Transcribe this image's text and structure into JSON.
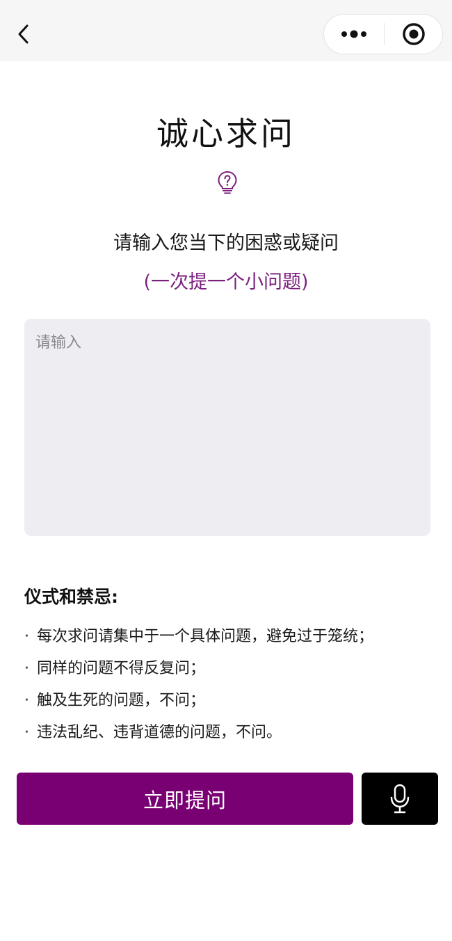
{
  "nav": {
    "back_icon": "chevron-left-icon",
    "more_icon": "more-dots-icon",
    "close_icon": "target-circle-icon"
  },
  "header": {
    "title": "诚心求问",
    "icon": "lightbulb-question-icon"
  },
  "prompt": {
    "line": "请输入您当下的困惑或疑问",
    "note": "(一次提一个小问题)"
  },
  "question": {
    "value": "",
    "placeholder": "请输入"
  },
  "rules": {
    "title": "仪式和禁忌:",
    "bullet": "·",
    "items": [
      "每次求问请集中于一个具体问题，避免过于笼统；",
      "同样的问题不得反复问；",
      "触及生死的问题，不问；",
      "违法乱纪、违背道德的问题，不问。"
    ]
  },
  "actions": {
    "submit_label": "立即提问",
    "voice_icon": "microphone-icon"
  },
  "colors": {
    "accent": "#790073",
    "accent_text": "#7a1f7d",
    "input_bg": "#ededf2",
    "nav_bg": "#f6f6f7",
    "voice_bg": "#000000"
  }
}
